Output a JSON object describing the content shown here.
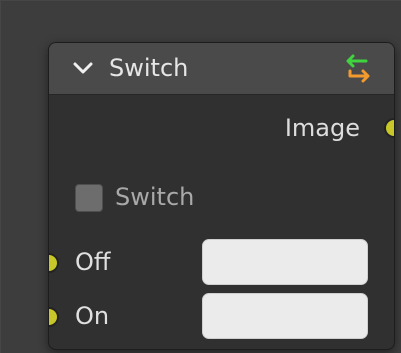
{
  "node": {
    "title": "Switch",
    "header_icon": "switch-arrows-icon",
    "collapse_icon": "chevron-down-icon"
  },
  "outputs": [
    {
      "label": "Image",
      "socket_color": "#c7c729"
    }
  ],
  "properties": {
    "switch_label": "Switch",
    "switch_checked": false
  },
  "inputs": [
    {
      "label": "Off",
      "socket_color": "#c7c729",
      "value": ""
    },
    {
      "label": "On",
      "socket_color": "#c7c729",
      "value": ""
    }
  ],
  "colors": {
    "background": "#3d3d3d",
    "node_body": "#303030",
    "node_header": "#4a4a4a",
    "socket": "#c7c729",
    "arrow_green": "#3fd43f",
    "arrow_orange": "#f29a2e"
  }
}
